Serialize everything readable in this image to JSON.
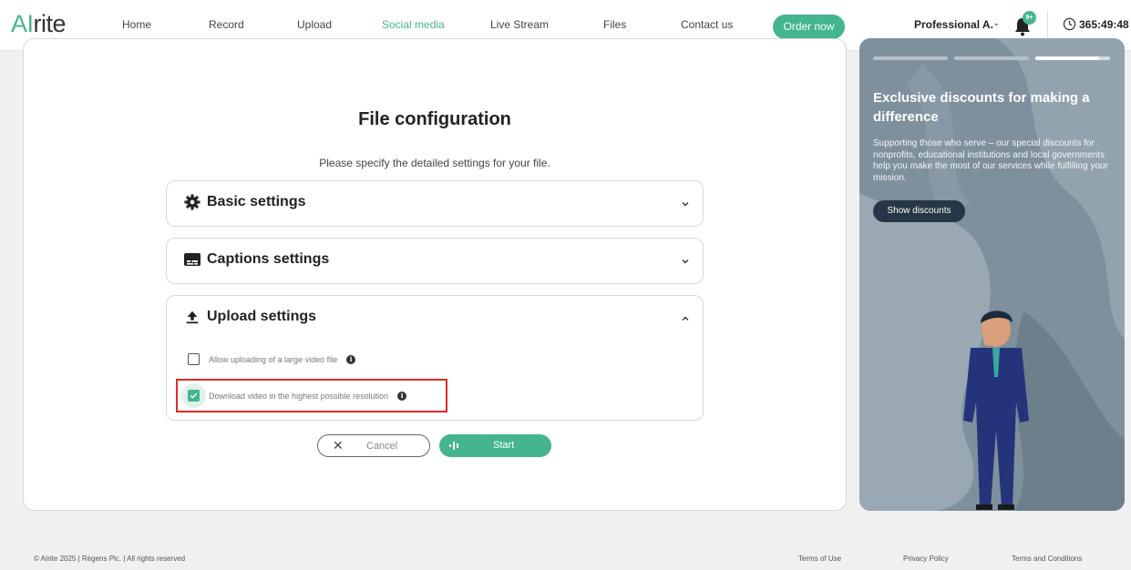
{
  "header": {
    "logo_prefix": "AI",
    "logo_suffix": "rite",
    "nav": [
      "Home",
      "Record",
      "Upload",
      "Social media",
      "Live Stream",
      "Files",
      "Contact us"
    ],
    "active_nav": "Social media",
    "order_button": "Order now",
    "user_name": "Professional A.",
    "notification_badge": "9+",
    "timer": "365:49:48"
  },
  "main": {
    "title": "File configuration",
    "subtitle": "Please specify the detailed settings for your file.",
    "sections": [
      {
        "label": "Basic settings",
        "icon": "gear-icon",
        "expanded": false
      },
      {
        "label": "Captions settings",
        "icon": "captions-icon",
        "expanded": false
      },
      {
        "label": "Upload settings",
        "icon": "upload-icon",
        "expanded": true
      }
    ],
    "upload_options": [
      {
        "label": "Allow uploading of a large video file",
        "checked": false
      },
      {
        "label": "Download video in the highest possible resolution",
        "checked": true
      }
    ],
    "cancel_label": "Cancel",
    "start_label": "Start"
  },
  "promo": {
    "title": "Exclusive discounts for making a difference",
    "text": "Supporting those who serve – our special discounts for nonprofits, educational institutions and local governments help you make the most of our services while fulfilling your mission.",
    "button": "Show discounts",
    "slides_total": 3,
    "active_slide": 3
  },
  "footer": {
    "copyright": "© AIrite 2025 | Régens Plc. | All rights reserved",
    "links": [
      "Terms of Use",
      "Privacy Policy",
      "Terms and Conditions"
    ]
  },
  "colors": {
    "accent": "#44b58e",
    "highlight": "#e02b2b",
    "promo_bg": "#7f909d",
    "promo_button": "#263646"
  }
}
